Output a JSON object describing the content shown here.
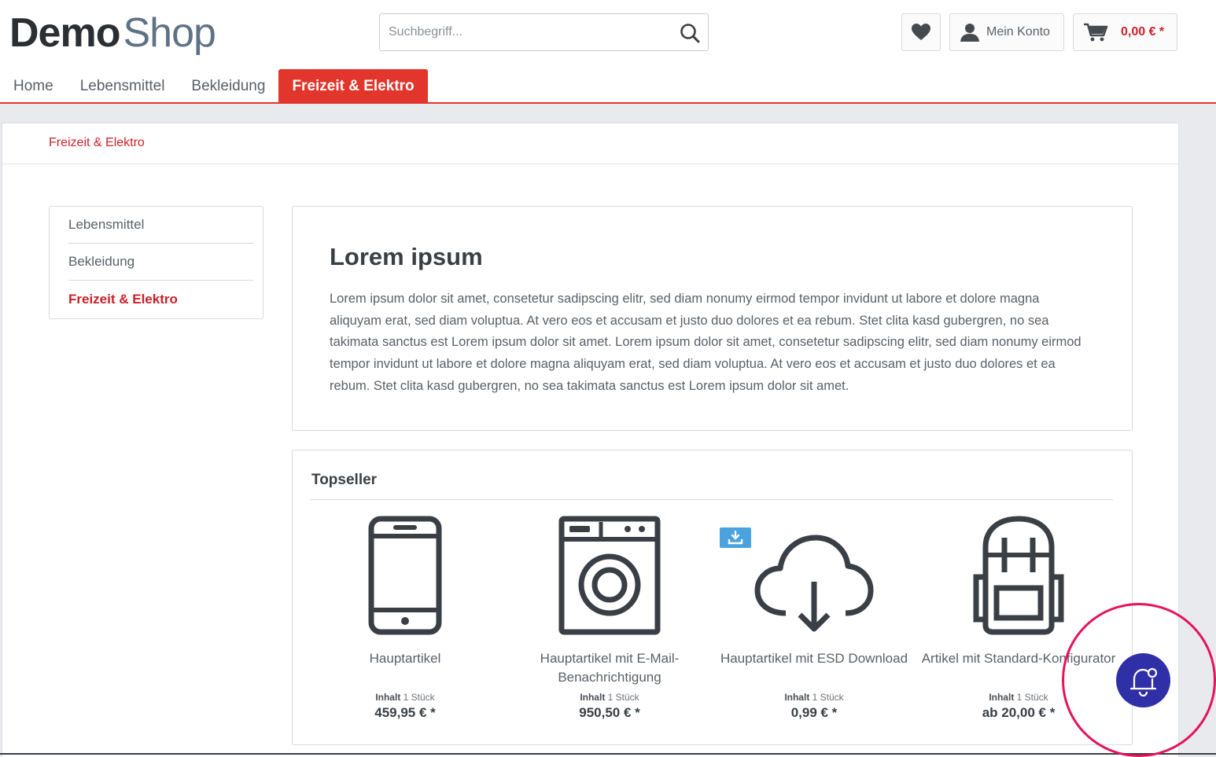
{
  "header": {
    "logo_demo": "Demo",
    "logo_shop": "Shop",
    "search_placeholder": "Suchbegriff...",
    "account_label": "Mein Konto",
    "cart_amount": "0,00 € *"
  },
  "nav": {
    "items": [
      {
        "label": "Home"
      },
      {
        "label": "Lebensmittel"
      },
      {
        "label": "Bekleidung"
      },
      {
        "label": "Freizeit & Elektro",
        "active": true
      }
    ]
  },
  "breadcrumb": "Freizeit & Elektro",
  "sidebar": {
    "items": [
      {
        "label": "Lebensmittel"
      },
      {
        "label": "Bekleidung"
      },
      {
        "label": "Freizeit & Elektro",
        "active": true
      }
    ]
  },
  "intro": {
    "title": "Lorem ipsum",
    "text": "Lorem ipsum dolor sit amet, consetetur sadipscing elitr, sed diam nonumy eirmod tempor invidunt ut labore et dolore magna aliquyam erat, sed diam voluptua. At vero eos et accusam et justo duo dolores et ea rebum. Stet clita kasd gubergren, no sea takimata sanctus est Lorem ipsum dolor sit amet. Lorem ipsum dolor sit amet, consetetur sadipscing elitr, sed diam nonumy eirmod tempor invidunt ut labore et dolore magna aliquyam erat, sed diam voluptua. At vero eos et accusam et justo duo dolores et ea rebum. Stet clita kasd gubergren, no sea takimata sanctus est Lorem ipsum dolor sit amet."
  },
  "topseller": {
    "title": "Topseller",
    "content_label": "Inhalt",
    "products": [
      {
        "name": "Hauptartikel",
        "content": "1 Stück",
        "price": "459,95 € *",
        "icon": "smartphone-icon"
      },
      {
        "name": "Hauptartikel mit E-Mail-Benachrichtigung",
        "content": "1 Stück",
        "price": "950,50 € *",
        "icon": "washing-machine-icon"
      },
      {
        "name": "Hauptartikel mit ESD Download",
        "content": "1 Stück",
        "price": "0,99 € *",
        "icon": "cloud-download-icon"
      },
      {
        "name": "Artikel mit Standard-Konfigurator",
        "content": "1 Stück",
        "price": "ab 20,00 € *",
        "icon": "backpack-icon"
      }
    ]
  },
  "colors": {
    "accent": "#e2352b",
    "text_red": "#d0202a",
    "bell_button": "#2f2fa8",
    "highlight_circle": "#e5125b",
    "esd_badge": "#4aa3df"
  }
}
